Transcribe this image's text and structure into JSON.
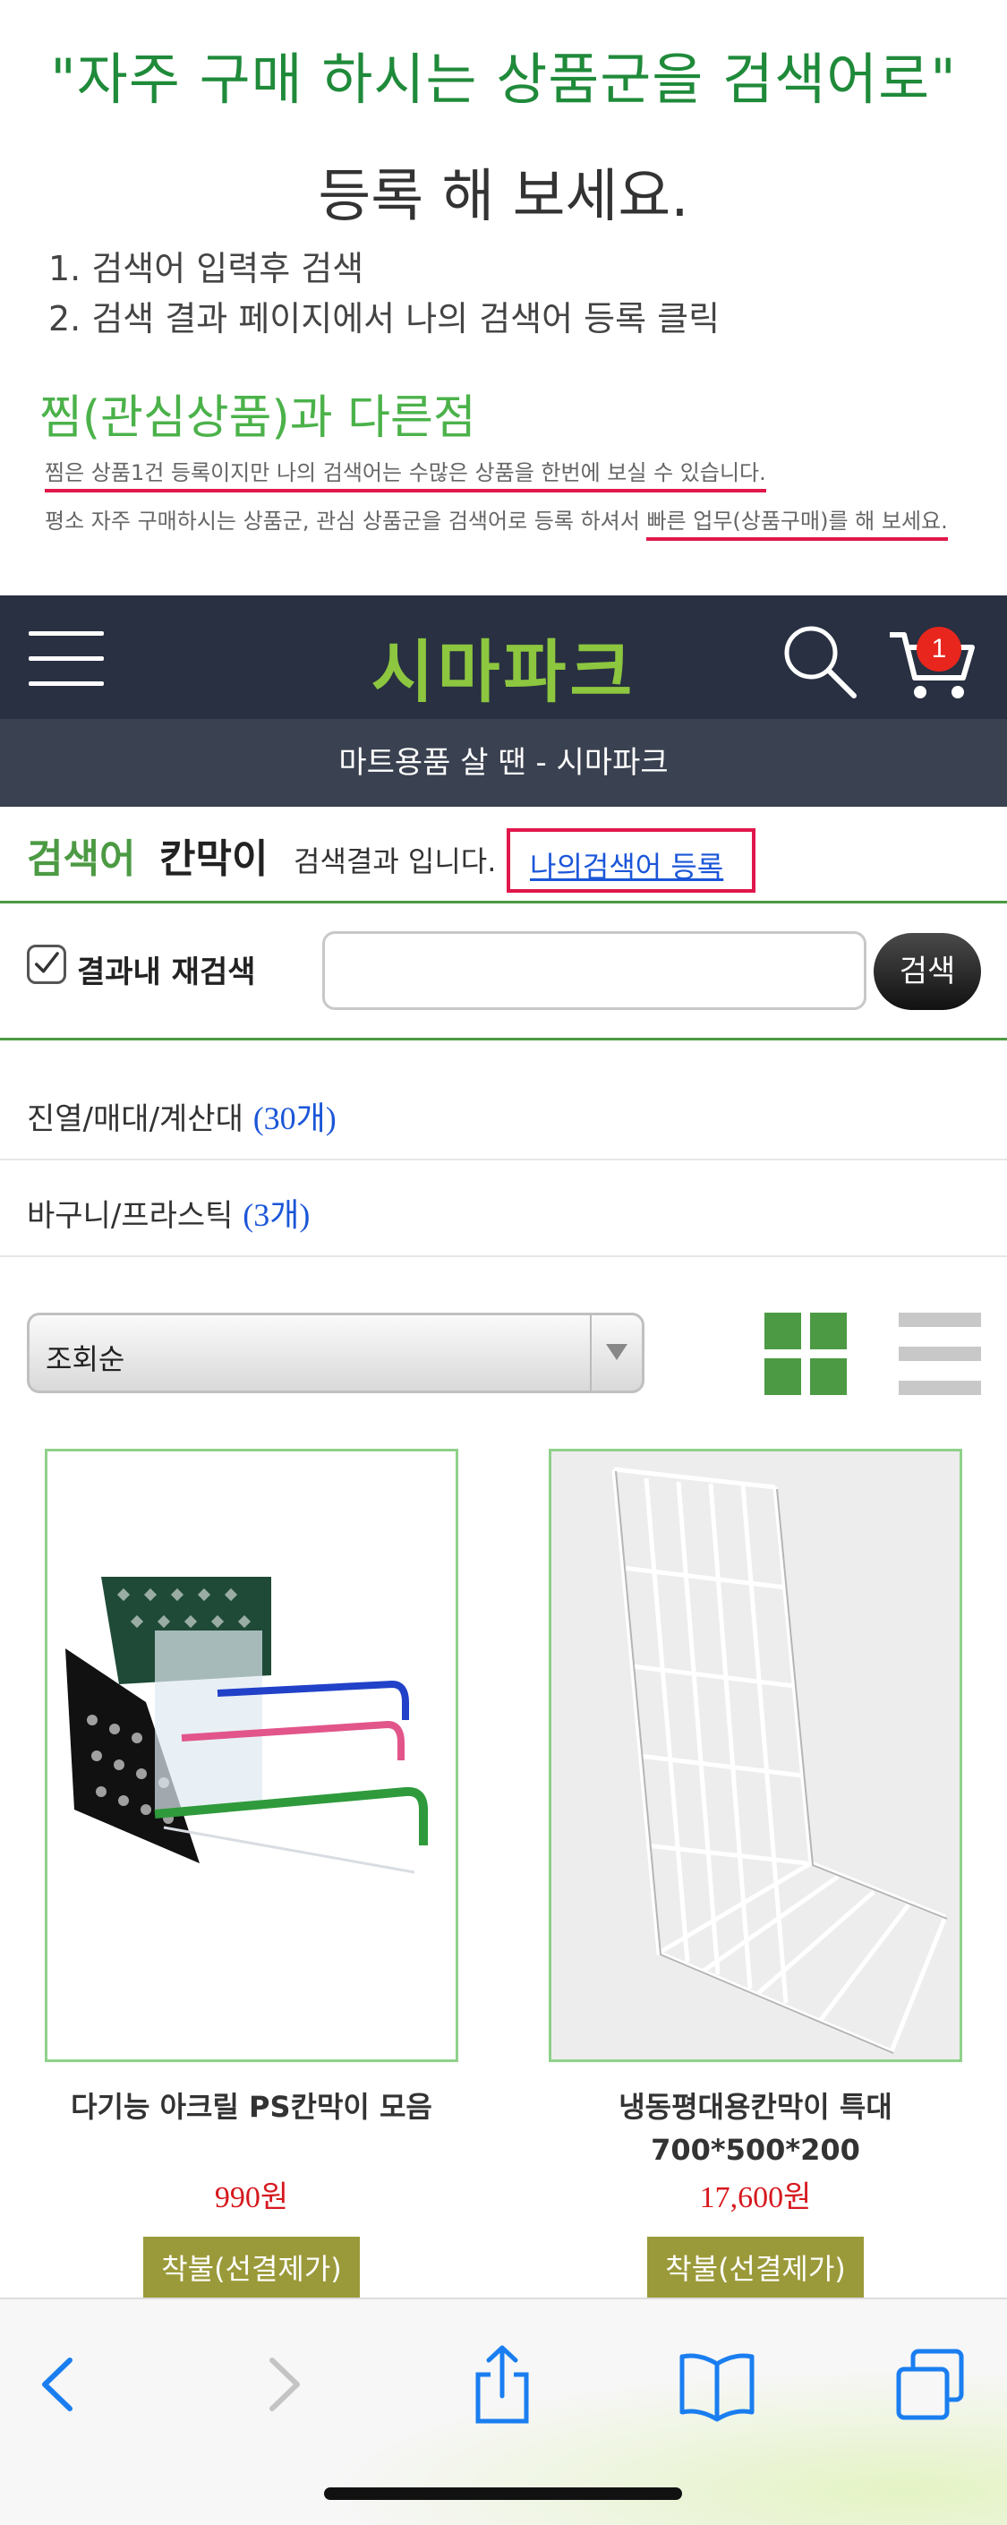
{
  "promo": {
    "title_line1": "\"자주 구매 하시는 상품군을 검색어로\"",
    "title_line2": "등록 해 보세요.",
    "steps": [
      "1. 검색어 입력후 검색",
      "2. 검색 결과 페이지에서 나의 검색어 등록 클릭"
    ],
    "subhead": "찜(관심상품)과 다른점",
    "line1_underlined": "찜은 상품1건 등록이지만 나의 검색어는 수많은 상품을 한번에 보실 수 있습니다.",
    "line2_plain": "평소 자주 구매하시는 상품군, 관심 상품군을 검색어로 등록 하셔서 ",
    "line2_underlined": "빠른 업무(상품구매)를 해 보세요."
  },
  "header": {
    "logo": "시마파크",
    "cart_count": "1",
    "tagline": "마트용품 살 땐 - 시마파크"
  },
  "search": {
    "label": "검색어",
    "keyword": "칸막이",
    "suffix": "검색결과 입니다.",
    "register_link": "나의검색어 등록",
    "research_label": "결과내 재검색",
    "research_value": "",
    "research_button": "검색"
  },
  "categories": [
    {
      "name": "진열/매대/계산대",
      "count": "(30개)"
    },
    {
      "name": "바구니/프라스틱",
      "count": "(3개)"
    }
  ],
  "sort": {
    "selected": "조회순"
  },
  "products": [
    {
      "name": "다기능 아크릴 PS칸막이 모음",
      "price": "990원",
      "badge": "착불(선결제가)"
    },
    {
      "name": "냉동평대용칸막이 특대 700*500*200",
      "price": "17,600원",
      "badge": "착불(선결제가)"
    }
  ],
  "colors": {
    "brand_green": "#8dc63f",
    "header_bg": "#283042",
    "accent_red": "#e0174b",
    "link_blue": "#1b56d8",
    "price_red": "#d6191f",
    "badge_olive": "#9b9a3a"
  },
  "icons": [
    "menu-icon",
    "search-icon",
    "cart-icon",
    "checkbox-icon",
    "grid-view-icon",
    "list-view-icon",
    "back-icon",
    "forward-icon",
    "share-icon",
    "bookmarks-icon",
    "tabs-icon"
  ]
}
